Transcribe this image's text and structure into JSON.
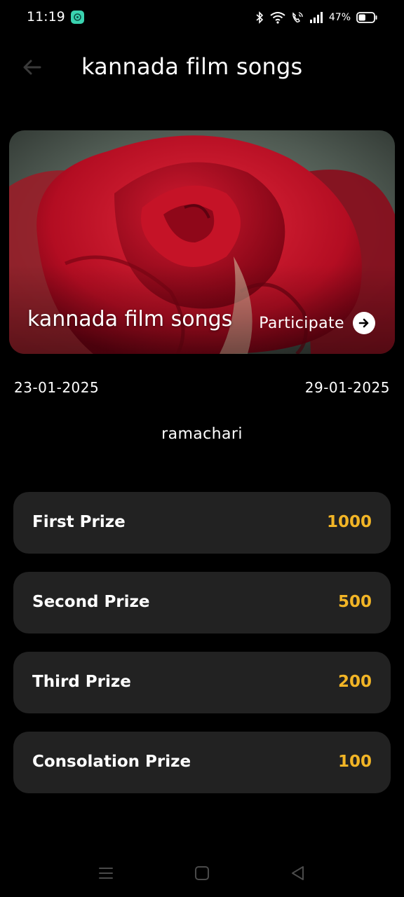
{
  "status_bar": {
    "time": "11:19",
    "battery_percent": "47%",
    "battery_level": 0.47
  },
  "header": {
    "title": "kannada film songs",
    "back_icon": "arrow-left-icon"
  },
  "hero": {
    "title": "kannada film songs",
    "participate_label": "Participate",
    "image": "red-rose"
  },
  "contest": {
    "start_date": "23-01-2025",
    "end_date": "29-01-2025",
    "organizer": "ramachari"
  },
  "prizes": [
    {
      "name": "First Prize",
      "amount": "1000"
    },
    {
      "name": "Second Prize",
      "amount": "500"
    },
    {
      "name": "Third Prize",
      "amount": "200"
    },
    {
      "name": "Consolation Prize",
      "amount": "100"
    }
  ],
  "colors": {
    "background": "#000000",
    "card": "#222222",
    "prize_amount": "#f2b526"
  }
}
